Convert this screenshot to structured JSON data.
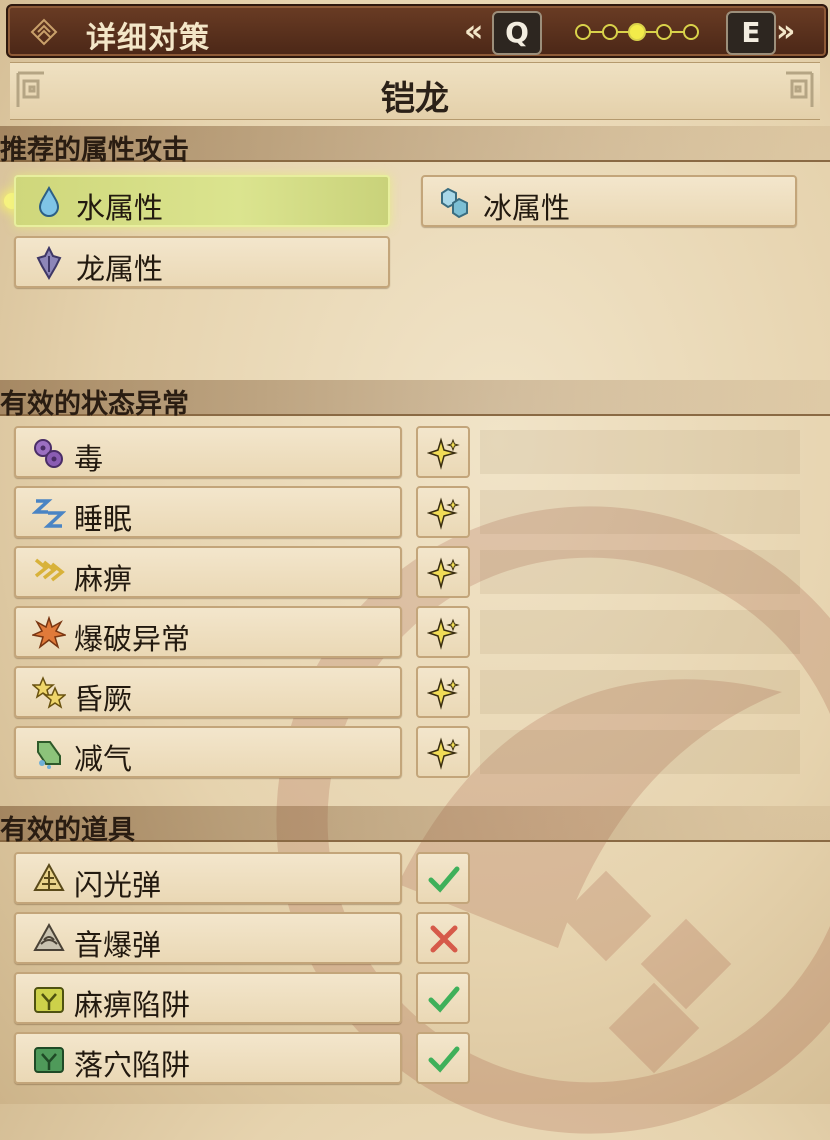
{
  "header": {
    "title": "详细对策",
    "prev_key": "Q",
    "next_key": "E",
    "prev_chevron": "«",
    "next_chevron": "»",
    "page_dots_total": 5,
    "page_dots_current": 3
  },
  "monster": {
    "name": "铠龙"
  },
  "sections": {
    "elements": {
      "title": "推荐的属性攻击",
      "items": [
        {
          "label": "水属性",
          "icon": "water-drop-icon"
        },
        {
          "label": "冰属性",
          "icon": "ice-crystal-icon"
        },
        {
          "label": "龙属性",
          "icon": "dragon-icon"
        }
      ]
    },
    "ailments": {
      "title": "有效的状态异常",
      "items": [
        {
          "label": "毒",
          "icon": "poison-icon",
          "rating": "sparkle-star-icon"
        },
        {
          "label": "睡眠",
          "icon": "sleep-icon",
          "rating": "sparkle-star-icon"
        },
        {
          "label": "麻痹",
          "icon": "paralysis-icon",
          "rating": "sparkle-star-icon"
        },
        {
          "label": "爆破异常",
          "icon": "blast-icon",
          "rating": "sparkle-star-icon"
        },
        {
          "label": "昏厥",
          "icon": "stun-icon",
          "rating": "sparkle-star-icon"
        },
        {
          "label": "减气",
          "icon": "exhaust-icon",
          "rating": "sparkle-star-icon"
        }
      ]
    },
    "items": {
      "title": "有效的道具",
      "items": [
        {
          "label": "闪光弹",
          "icon": "flash-pod-icon",
          "effective": true
        },
        {
          "label": "音爆弹",
          "icon": "sonic-bomb-icon",
          "effective": false
        },
        {
          "label": "麻痹陷阱",
          "icon": "shock-trap-icon",
          "effective": true
        },
        {
          "label": "落穴陷阱",
          "icon": "pitfall-trap-icon",
          "effective": true
        }
      ]
    }
  },
  "colors": {
    "check": "#3fb05a",
    "cross": "#d65a4a",
    "sparkle": "#f1dc56",
    "title_bar": "#5a3220",
    "selected": "#d6de86"
  }
}
